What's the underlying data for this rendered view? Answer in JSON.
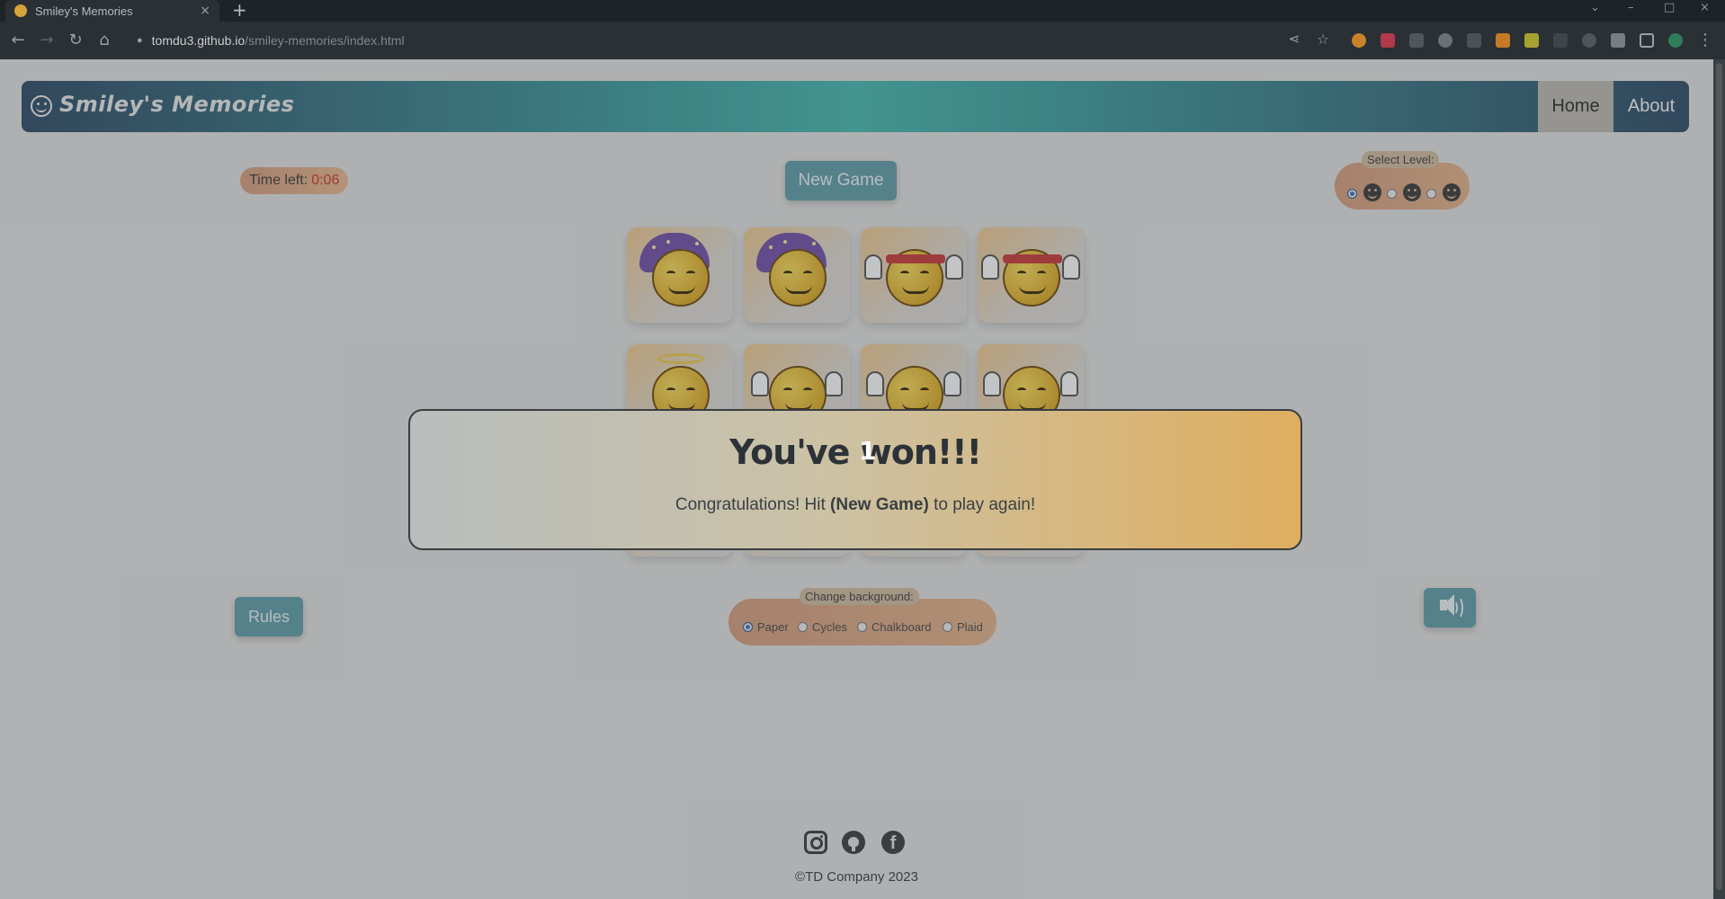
{
  "browser": {
    "tab_title": "Smiley's Memories",
    "tab_close": "×",
    "new_tab": "+",
    "url_host": "tomdu3.github.io",
    "url_path": "/smiley-memories/index.html"
  },
  "navbar": {
    "brand": "Smiley's Memories",
    "home": "Home",
    "about": "About"
  },
  "timer": {
    "label": "Time left:",
    "value": "0:06",
    "value_color": "#c53a2a"
  },
  "buttons": {
    "new_game": "New Game",
    "rules": "Rules",
    "sound_icon": "speaker-icon"
  },
  "level": {
    "label": "Select Level:",
    "options": [
      "easy",
      "medium",
      "hard"
    ],
    "selected": "easy"
  },
  "cards": [
    "sleepy-smiley",
    "sleepy-smiley",
    "peace-smiley",
    "peace-smiley",
    "angel-smiley",
    "waving-smiley",
    "cheering-smiley",
    "cheering-smiley"
  ],
  "modal": {
    "title": "You've won!!!",
    "cursor_text": "1",
    "text_before": "Congratulations! Hit ",
    "text_bold": "(New Game)",
    "text_after": " to play again!"
  },
  "background": {
    "label": "Change background:",
    "options": [
      "Paper",
      "Cycles",
      "Chalkboard",
      "Plaid"
    ],
    "selected": "Paper"
  },
  "footer": {
    "copyright": "©TD Company 2023",
    "social": [
      "instagram-icon",
      "github-icon",
      "facebook-icon"
    ]
  },
  "colors": {
    "accent_teal": "#5f9aa7",
    "modal_orange": "#dfae5f",
    "radio_selected": "#3d6fb8"
  }
}
